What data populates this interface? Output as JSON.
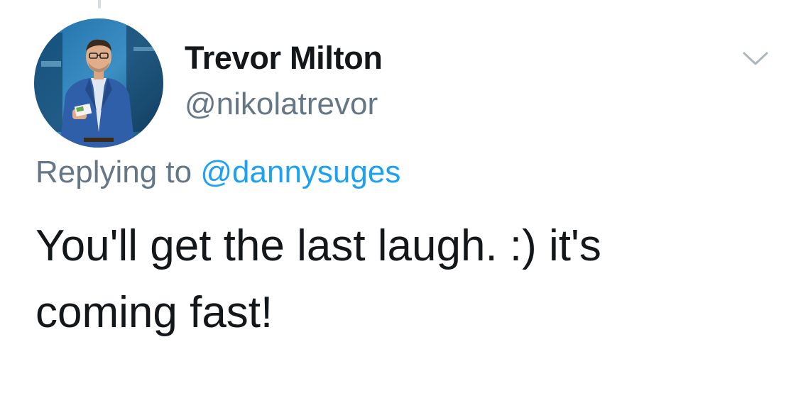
{
  "tweet": {
    "author": {
      "display_name": "Trevor Milton",
      "handle": "@nikolatrevor"
    },
    "reply": {
      "prefix": "Replying to",
      "mention": "@dannysuges"
    },
    "text_line1": "You'll get the last laugh. :) it's",
    "text_line2": "coming fast!",
    "menu_icon": "chevron-down-icon"
  },
  "colors": {
    "text_primary": "#14171a",
    "text_secondary": "#657786",
    "link": "#1da1f2",
    "background": "#ffffff"
  }
}
